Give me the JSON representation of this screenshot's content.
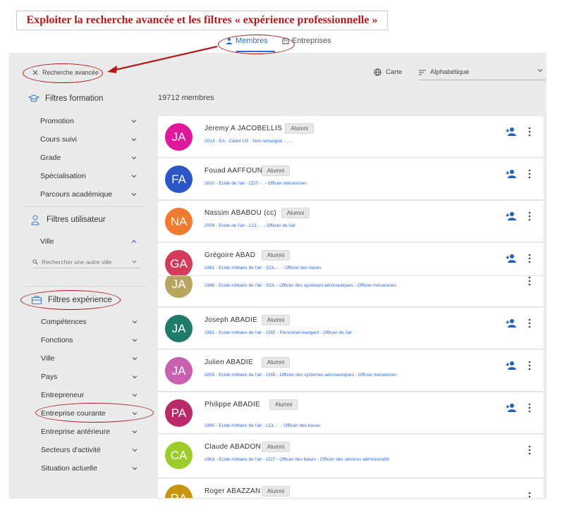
{
  "title": "Exploiter la recherche avancée et les filtres « expérience professionnelle »",
  "tabs": [
    {
      "label": "Membres",
      "icon": "person-icon",
      "active": true
    },
    {
      "label": "Entreprises",
      "icon": "building-icon",
      "active": false
    }
  ],
  "toolbar": {
    "advanced_search": "Recherche avancée",
    "map": "Carte",
    "sort": "Alphabétique"
  },
  "member_count": "19712 membres",
  "sidebar": {
    "formation": {
      "title": "Filtres formation",
      "items": [
        "Promotion",
        "Cours suivi",
        "Grade",
        "Spécialisation",
        "Parcours académique"
      ]
    },
    "user": {
      "title": "Filtres utilisateur",
      "items": [
        "Ville"
      ],
      "city_search_placeholder": "Rechercher une autre ville"
    },
    "experience": {
      "title": "Filtres expérience",
      "items": [
        "Compétences",
        "Fonctions",
        "Ville",
        "Pays",
        "Entrepreneur",
        "Entreprise courante",
        "Entreprise antérieure",
        "Secteurs d'activité",
        "Situation actuelle"
      ]
    }
  },
  "members": [
    {
      "initials": "JA",
      "color": "#e0189c",
      "name": "Jeremy A JACOBELLIS",
      "badge": "Alumni",
      "details": "2014 - EA - Cadet US - Non renseigné - . - .",
      "add": true
    },
    {
      "initials": "FA",
      "color": "#2b56c8",
      "name": "Fouad AAFFOUN",
      "badge": "Alumni",
      "details": "2010 - Ecole de l'air - CDT - . - Officier mécanicien",
      "add": true
    },
    {
      "initials": "NA",
      "color": "#f07a30",
      "name": "Nassim ABABOU (cc)",
      "badge": "Alumni",
      "details": "2009 - Ecole de l'air - LCL - . - Officier de l'air",
      "add": true
    },
    {
      "initials": "GA",
      "color": "#d43a5a",
      "name": "Grégoire ABAD",
      "badge": "Alumni",
      "details": "1961 - Ecole militaire de l'air - COL - . - Officier des bases",
      "add": true
    },
    {
      "initials": "JA",
      "color": "#b8a660",
      "name": "",
      "badge": "",
      "details": "1946 - Ecole militaire de l'air - COL - Officier des systèmes aéronautiques - Officier mécanicien",
      "add": false
    },
    {
      "initials": "JA",
      "color": "#1f7a6a",
      "name": "Joseph ABADIE",
      "badge": "Alumni",
      "details": "1981 - Ecole militaire de l'air - CNE - Personnel navigant - Officier de l'air",
      "add": true
    },
    {
      "initials": "JA",
      "color": "#c95fb0",
      "name": "Julien ABADIE",
      "badge": "Alumni",
      "details": "2005 - Ecole militaire de l'air - CNE - Officier des systèmes aéronautiques - Officier mécanicien",
      "add": true
    },
    {
      "initials": "PA",
      "color": "#b82a6a",
      "name": "Philippe ABADIE",
      "badge": "Alumni",
      "details": "1990 - Ecole militaire de l'air - LCL - . - Officier des bases",
      "add": true
    },
    {
      "initials": "CA",
      "color": "#9ccc2a",
      "name": "Claude ABADON",
      "badge": "Alumni",
      "details": "1963 - Ecole militaire de l'air - CDT - Officier des bases - Officier des services administratifs",
      "add": false
    },
    {
      "initials": "RA",
      "color": "#c8960c",
      "name": "Roger ABAZZAN",
      "badge": "Alumni",
      "details": "",
      "add": false
    }
  ]
}
